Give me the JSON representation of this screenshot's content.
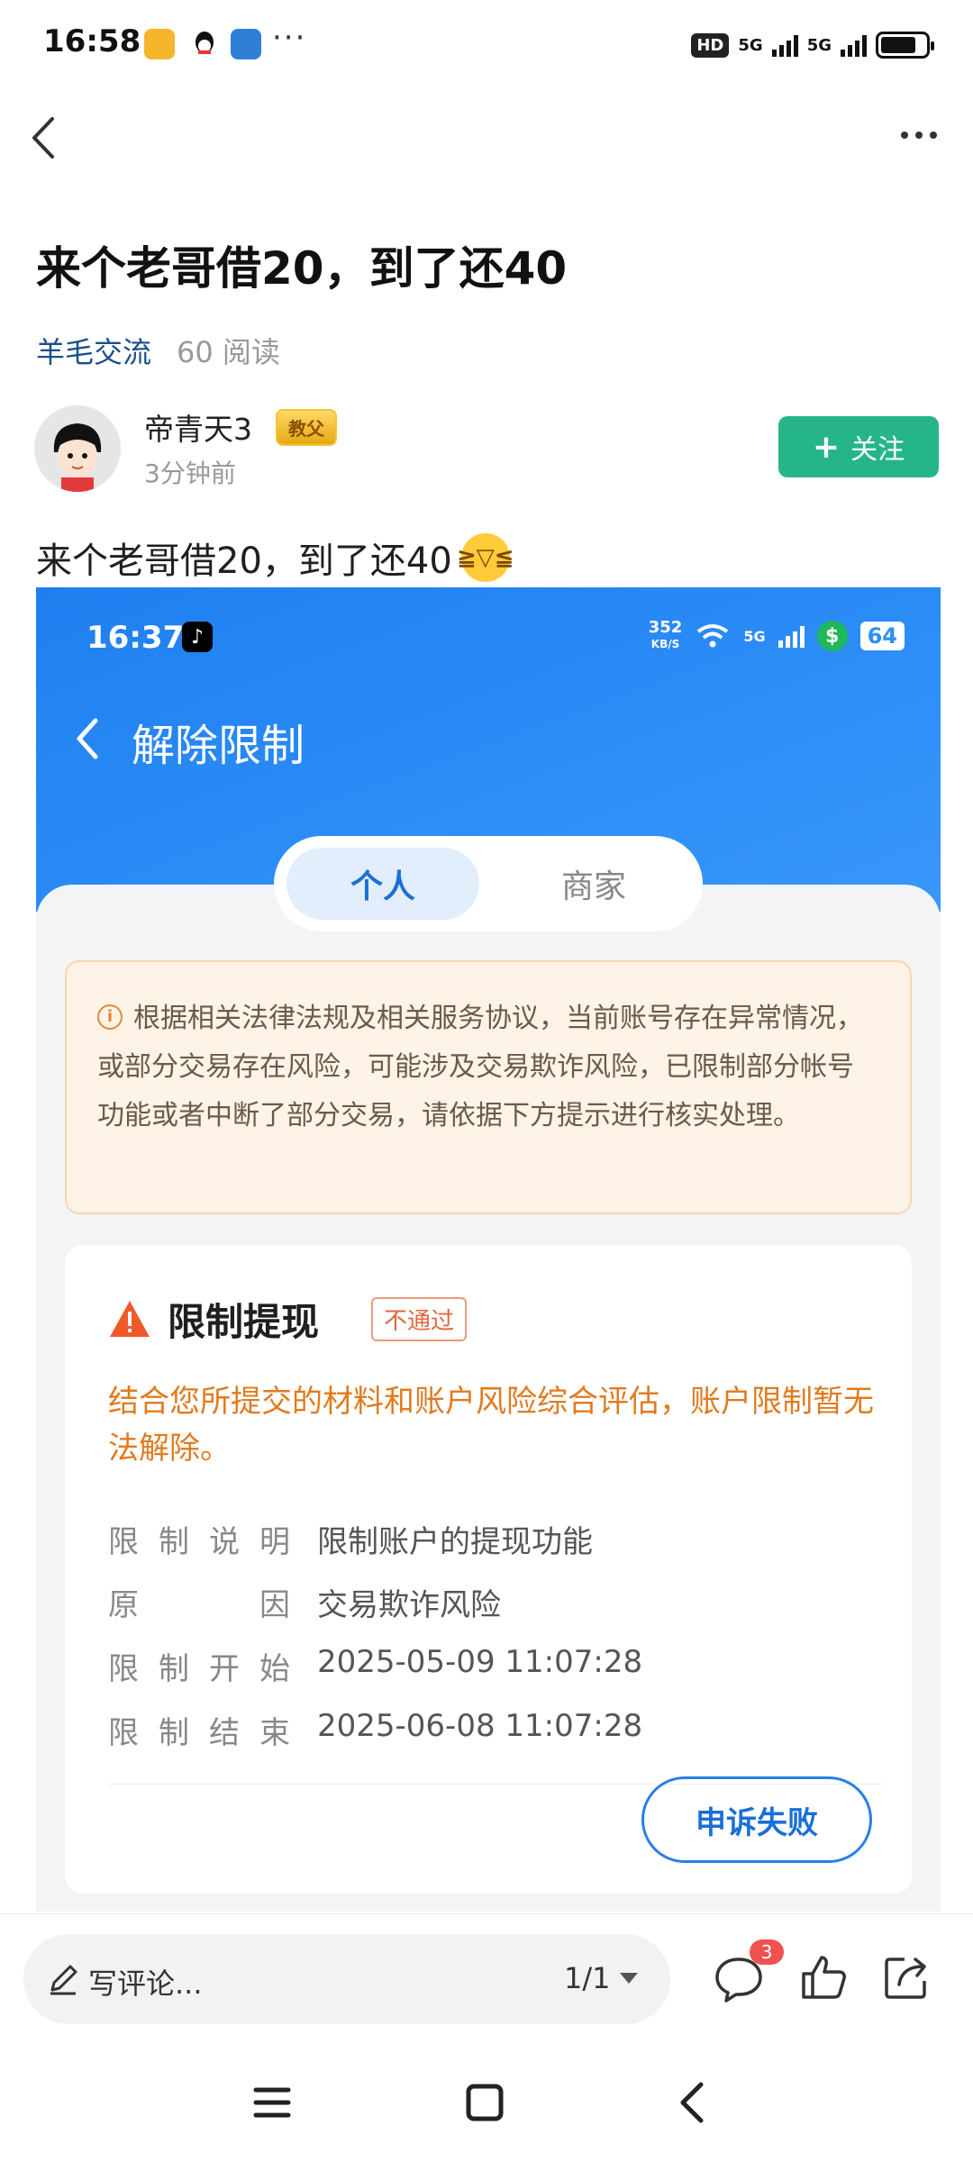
{
  "status_bar": {
    "time": "16:58",
    "hd_label": "HD",
    "network_1": "5G",
    "network_2": "5G",
    "battery_percent": 80
  },
  "post": {
    "title": "来个老哥借20，到了还40",
    "category": "羊毛交流",
    "reads": "60 阅读",
    "author": {
      "name": "帝青天3",
      "badge": "教父",
      "time_ago": "3分钟前"
    },
    "follow_label": "关注",
    "body_text": "来个老哥借20，到了还40"
  },
  "embedded": {
    "status": {
      "time": "16:37",
      "speed_value": "352",
      "speed_unit": "KB/S",
      "network": "5G",
      "battery": "64"
    },
    "page_title": "解除限制",
    "tabs": [
      {
        "label": "个人",
        "active": true
      },
      {
        "label": "商家",
        "active": false
      }
    ],
    "notice": "根据相关法律法规及相关服务协议，当前账号存在异常情况，或部分交易存在风险，可能涉及交易欺诈风险，已限制部分帐号功能或者中断了部分交易，请依据下方提示进行核实处理。",
    "card": {
      "title": "限制提现",
      "status": "不通过",
      "message": "结合您所提交的材料和账户风险综合评估，账户限制暂无法解除。",
      "rows": [
        {
          "key": [
            "限",
            "制",
            "说",
            "明"
          ],
          "value": "限制账户的提现功能"
        },
        {
          "key": [
            "原",
            "因"
          ],
          "value": "交易欺诈风险"
        },
        {
          "key": [
            "限",
            "制",
            "开",
            "始"
          ],
          "value": "2025-05-09 11:07:28"
        },
        {
          "key": [
            "限",
            "制",
            "结",
            "束"
          ],
          "value": "2025-06-08 11:07:28"
        }
      ],
      "appeal_label": "申诉失败"
    }
  },
  "bottom_bar": {
    "comment_placeholder": "写评论...",
    "page_indicator": "1/1",
    "comment_count": "3"
  },
  "colors": {
    "accent_green": "#26b58a",
    "blue": "#2d8ef7",
    "warning_orange": "#e07b1f"
  }
}
